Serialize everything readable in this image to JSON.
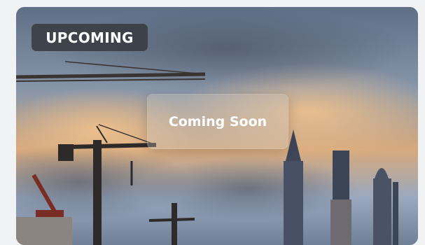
{
  "card": {
    "badge_label": "UPCOMING",
    "status_label": "Coming Soon",
    "image_subject": "construction-cranes-and-skyscrapers-at-sunset"
  },
  "colors": {
    "badge_background": "#373a40",
    "overlay_background": "#cdc6be",
    "text": "#ffffff"
  }
}
